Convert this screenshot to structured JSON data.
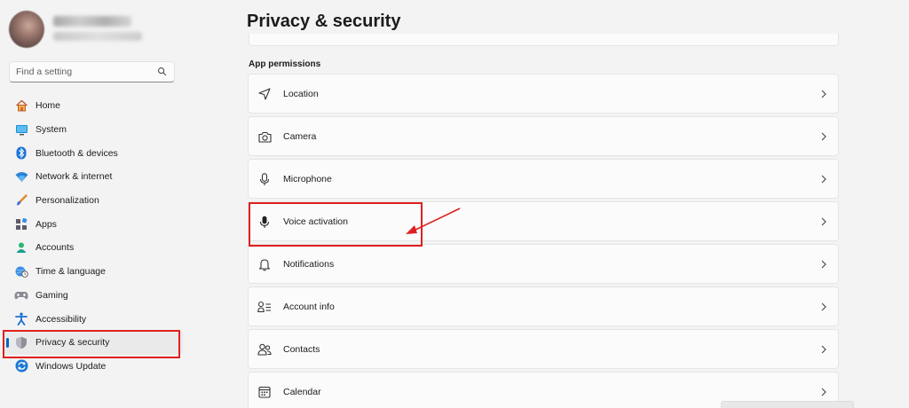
{
  "profile": {
    "name_blurred": "",
    "email_blurred": ""
  },
  "search": {
    "placeholder": "Find a setting"
  },
  "sidebar": {
    "items": [
      {
        "label": "Home",
        "icon": "home-icon"
      },
      {
        "label": "System",
        "icon": "system-icon"
      },
      {
        "label": "Bluetooth & devices",
        "icon": "bluetooth-icon"
      },
      {
        "label": "Network & internet",
        "icon": "wifi-icon"
      },
      {
        "label": "Personalization",
        "icon": "brush-icon"
      },
      {
        "label": "Apps",
        "icon": "apps-icon"
      },
      {
        "label": "Accounts",
        "icon": "accounts-icon"
      },
      {
        "label": "Time & language",
        "icon": "globe-clock-icon"
      },
      {
        "label": "Gaming",
        "icon": "gamepad-icon"
      },
      {
        "label": "Accessibility",
        "icon": "accessibility-icon"
      },
      {
        "label": "Privacy & security",
        "icon": "shield-icon",
        "active": true
      },
      {
        "label": "Windows Update",
        "icon": "update-icon"
      }
    ]
  },
  "main": {
    "title": "Privacy & security",
    "section_label": "App permissions",
    "permissions": [
      {
        "label": "Location",
        "icon": "location-arrow-icon"
      },
      {
        "label": "Camera",
        "icon": "camera-icon"
      },
      {
        "label": "Microphone",
        "icon": "microphone-icon"
      },
      {
        "label": "Voice activation",
        "icon": "voice-activation-icon"
      },
      {
        "label": "Notifications",
        "icon": "bell-icon"
      },
      {
        "label": "Account info",
        "icon": "account-info-icon"
      },
      {
        "label": "Contacts",
        "icon": "contacts-icon"
      },
      {
        "label": "Calendar",
        "icon": "calendar-icon"
      }
    ]
  },
  "colors": {
    "accent": "#0067c0",
    "annotation_red": "#e02020",
    "background": "#f3f3f3",
    "card": "#fbfbfb"
  }
}
